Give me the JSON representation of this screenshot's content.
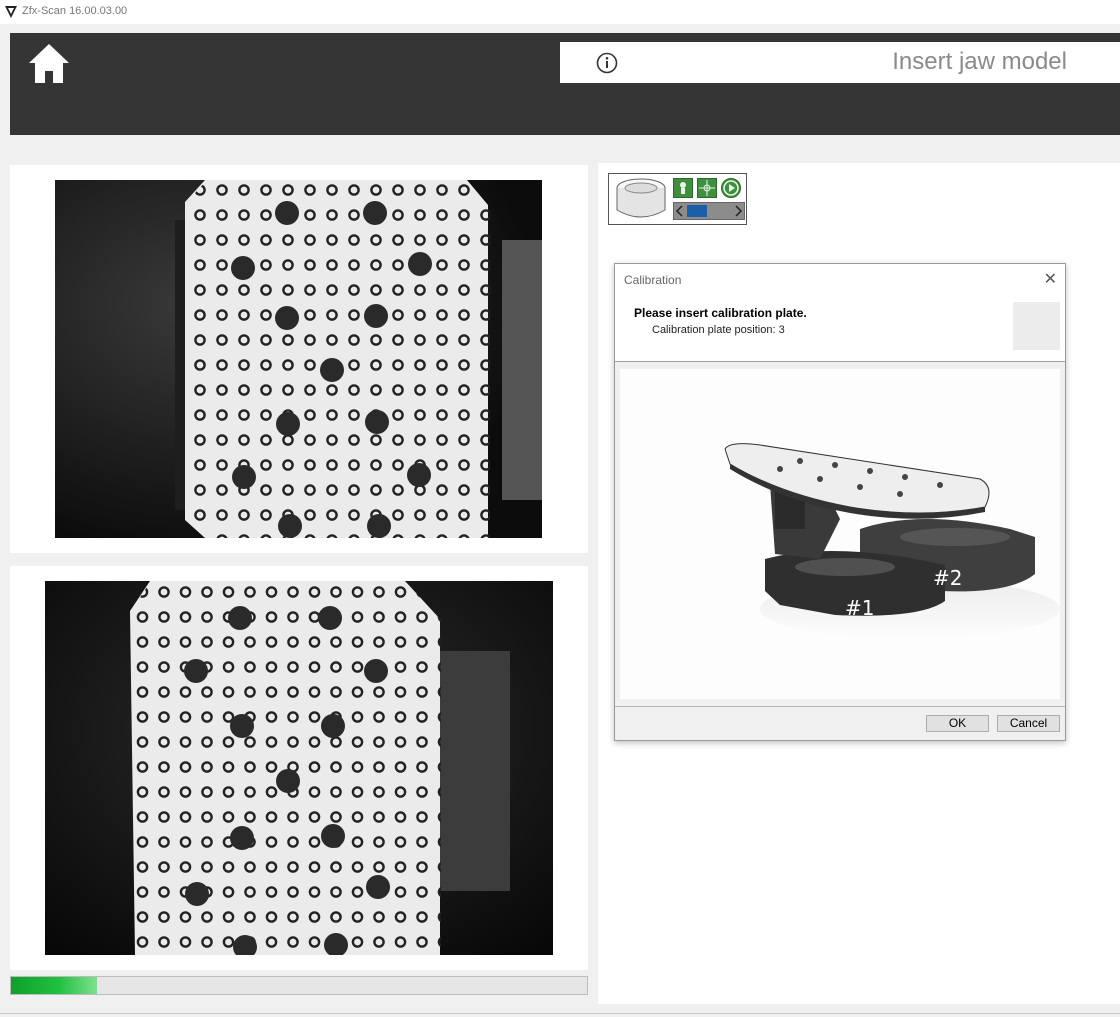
{
  "app": {
    "title": "Zfx-Scan 16.00.03.00"
  },
  "header": {
    "instruction": "Insert jaw model"
  },
  "progress": {
    "fraction": 0.15
  },
  "dialog": {
    "title": "Calibration",
    "message": "Please insert calibration plate.",
    "position_text": "Calibration plate position: 3",
    "ok_label": "OK",
    "cancel_label": "Cancel",
    "image_labels": {
      "one": "#1",
      "two": "#2"
    }
  },
  "colors": {
    "header_bg": "#353535",
    "progress_green": "#20c040",
    "accent_blue": "#1a5fa8"
  },
  "icons": [
    "app-logo-icon",
    "home-icon",
    "info-icon",
    "close-icon",
    "scan-tool-icon",
    "arrow-left-icon",
    "arrow-right-icon"
  ]
}
